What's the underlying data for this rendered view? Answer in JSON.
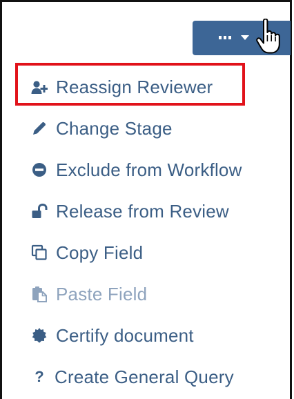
{
  "toolbar": {
    "more_icon": "ellipsis-icon",
    "caret_icon": "caret-down-icon",
    "accent_color": "#3d6696"
  },
  "menu": {
    "text_color": "#3b5e85",
    "disabled_color": "#8ea3bd",
    "highlight_color": "#e1121a",
    "items": [
      {
        "label": "Reassign Reviewer",
        "icon": "user-plus-icon",
        "enabled": true,
        "highlighted": true
      },
      {
        "label": "Change Stage",
        "icon": "pencil-icon",
        "enabled": true,
        "highlighted": false
      },
      {
        "label": "Exclude from Workflow",
        "icon": "minus-circle-icon",
        "enabled": true,
        "highlighted": false
      },
      {
        "label": "Release from Review",
        "icon": "unlock-icon",
        "enabled": true,
        "highlighted": false
      },
      {
        "label": "Copy Field",
        "icon": "copy-icon",
        "enabled": true,
        "highlighted": false
      },
      {
        "label": "Paste Field",
        "icon": "paste-icon",
        "enabled": false,
        "highlighted": false
      },
      {
        "label": "Certify document",
        "icon": "certificate-icon",
        "enabled": true,
        "highlighted": false
      },
      {
        "label": "Create General Query",
        "icon": "question-icon",
        "glyph": "?",
        "enabled": true,
        "highlighted": false
      }
    ]
  }
}
